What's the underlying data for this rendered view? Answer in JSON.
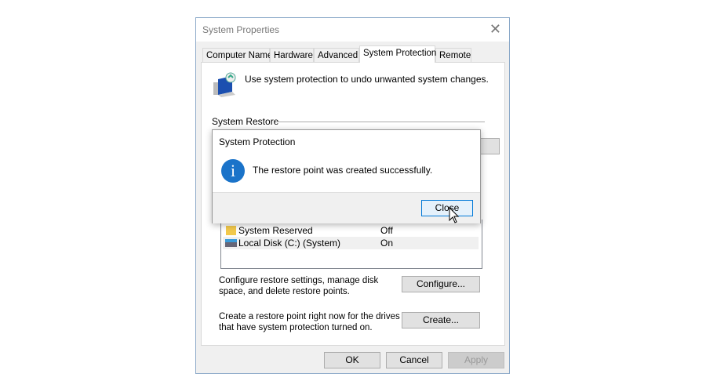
{
  "window": {
    "title": "System Properties",
    "close_icon": "close-icon"
  },
  "tabs": [
    {
      "label": "Computer Name"
    },
    {
      "label": "Hardware"
    },
    {
      "label": "Advanced"
    },
    {
      "label": "System Protection",
      "active": true
    },
    {
      "label": "Remote"
    }
  ],
  "panel": {
    "intro": "Use system protection to undo unwanted system changes.",
    "restore_group": "System Restore",
    "drives": [
      {
        "name": "System Reserved",
        "protection": "Off",
        "icon": "folder-icon"
      },
      {
        "name": "Local Disk (C:) (System)",
        "protection": "On",
        "icon": "drive-icon"
      }
    ],
    "configure_text": "Configure restore settings, manage disk space, and delete restore points.",
    "configure_button": "Configure...",
    "create_text": "Create a restore point right now for the drives that have system protection turned on.",
    "create_button": "Create..."
  },
  "footer": {
    "ok": "OK",
    "cancel": "Cancel",
    "apply": "Apply"
  },
  "dialog": {
    "title": "System Protection",
    "message": "The restore point was created successfully.",
    "close_button": "Close",
    "icon": "info-icon"
  },
  "colors": {
    "info": "#1a73c9",
    "focus_border": "#0078d7"
  }
}
